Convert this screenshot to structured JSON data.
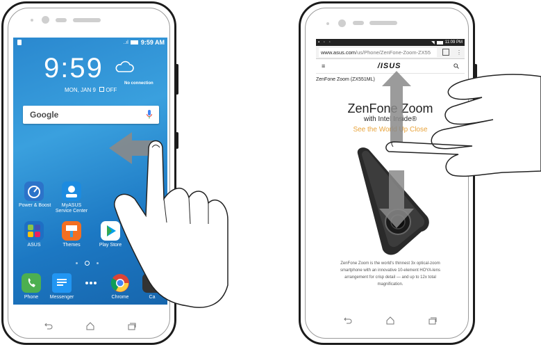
{
  "left_phone": {
    "status_time": "9:59 AM",
    "clock": "9:59",
    "date": "MON, JAN 9",
    "alarm": "OFF",
    "weather_text": "No connection",
    "search_brand": "Google",
    "apps": [
      {
        "label": "Power & Boost",
        "icon": "power-boost-icon",
        "color": "#2c73c9"
      },
      {
        "label": "MyASUS Service Center",
        "icon": "myasus-icon",
        "color": "#1c8be0"
      },
      {
        "label": "ASUS",
        "icon": "asus-folder-icon",
        "color": "#1e6fc4"
      },
      {
        "label": "Themes",
        "icon": "themes-icon",
        "color": "#f36f21"
      },
      {
        "label": "Play Store",
        "icon": "play-store-icon",
        "color": "#ffffff"
      }
    ],
    "dock": [
      {
        "label": "Phone",
        "icon": "phone-icon",
        "color": "#4caf50"
      },
      {
        "label": "Messenger",
        "icon": "messenger-icon",
        "color": "#2196f3"
      },
      {
        "label": "",
        "icon": "apps-drawer-icon",
        "color": ""
      },
      {
        "label": "Chrome",
        "icon": "chrome-icon",
        "color": ""
      },
      {
        "label": "Ca",
        "icon": "camera-icon",
        "color": ""
      }
    ]
  },
  "right_phone": {
    "status_time": "11:09 PM",
    "url_host": "www.asus.com",
    "url_path": "/us/Phone/ZenFone-Zoom-ZX55",
    "site_logo": "/ISUS",
    "breadcrumb": "ZenFone Zoom (ZX551ML)",
    "product_title": "ZenFone Zoom",
    "product_sub": "with Intel Inside®",
    "tagline": "See the World Up Close",
    "description": "ZenFone Zoom is the world's thinnest 3x optical-zoom smartphone with an innovative 10-element HOYA-lens arrangement for crisp detail — and up to 12x total magnification."
  },
  "colors": {
    "accent_orange": "#e8a33a",
    "wallpaper": "#2a88cf",
    "gesture_arrow": "#8a8a8a"
  }
}
